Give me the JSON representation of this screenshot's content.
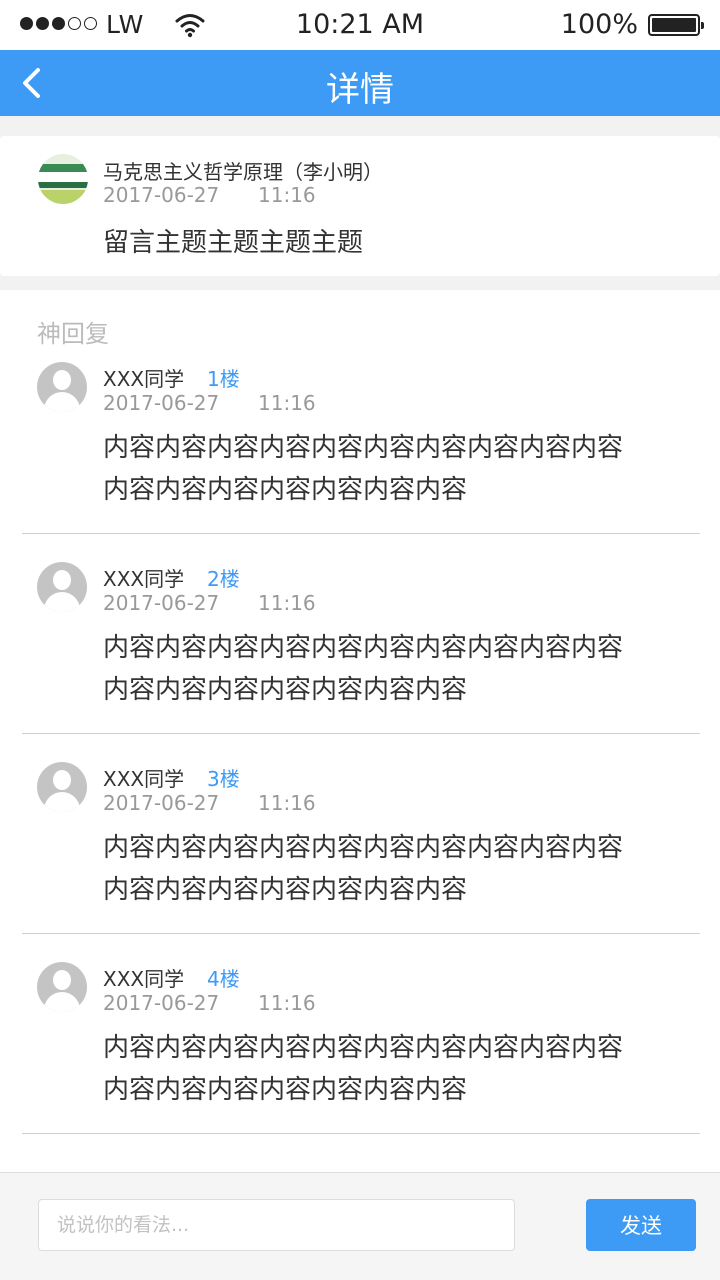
{
  "status_bar": {
    "carrier": "LW",
    "time": "10:21 AM",
    "battery": "100%",
    "signal_icon": "signal-dots-icon",
    "wifi_icon": "wifi-icon"
  },
  "nav": {
    "title": "详情",
    "back_icon": "chevron-left-icon",
    "color": "#3d9af5"
  },
  "topic": {
    "course": "马克思主义哲学原理（李小明）",
    "date": "2017-06-27",
    "time": "11:16",
    "subject": "留言主题主题主题主题"
  },
  "replies": {
    "title": "神回复",
    "items": [
      {
        "name": "XXX同学",
        "floor": "1楼",
        "date": "2017-06-27",
        "time": "11:16",
        "content": "内容内容内容内容内容内容内容内容内容内容内容内容内容内容内容内容内容"
      },
      {
        "name": "XXX同学",
        "floor": "2楼",
        "date": "2017-06-27",
        "time": "11:16",
        "content": "内容内容内容内容内容内容内容内容内容内容内容内容内容内容内容内容内容"
      },
      {
        "name": "XXX同学",
        "floor": "3楼",
        "date": "2017-06-27",
        "time": "11:16",
        "content": "内容内容内容内容内容内容内容内容内容内容内容内容内容内容内容内容内容"
      },
      {
        "name": "XXX同学",
        "floor": "4楼",
        "date": "2017-06-27",
        "time": "11:16",
        "content": "内容内容内容内容内容内容内容内容内容内容内容内容内容内容内容内容内容"
      }
    ]
  },
  "input_bar": {
    "placeholder": "说说你的看法...",
    "value": "",
    "send_label": "发送"
  }
}
